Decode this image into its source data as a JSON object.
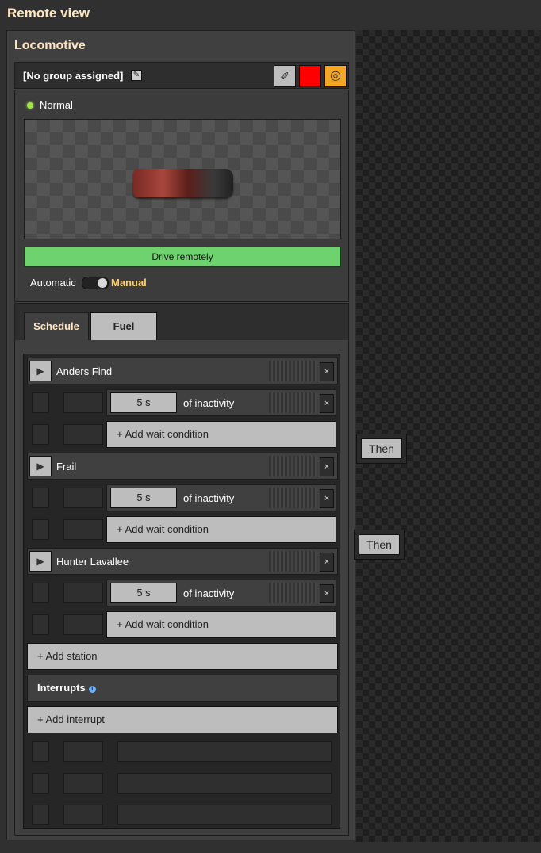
{
  "window": {
    "title": "Remote view"
  },
  "panel": {
    "title": "Locomotive",
    "group_label": "[No group assigned]",
    "color_hex": "#ff0000",
    "status": "Normal",
    "drive_label": "Drive remotely",
    "automatic_label": "Automatic",
    "manual_label": "Manual"
  },
  "tabs": [
    {
      "label": "Schedule",
      "active": true
    },
    {
      "label": "Fuel",
      "active": false
    }
  ],
  "schedule": {
    "stations": [
      {
        "name": "Anders Find",
        "condition": {
          "time": "5 s",
          "text": "of inactivity"
        }
      },
      {
        "name": "Frail",
        "condition": {
          "time": "5 s",
          "text": "of inactivity"
        }
      },
      {
        "name": "Hunter Lavallee",
        "condition": {
          "time": "5 s",
          "text": "of inactivity"
        }
      }
    ],
    "add_wait_label": "+ Add wait condition",
    "add_station_label": "+ Add station",
    "interrupts_label": "Interrupts",
    "add_interrupt_label": "+ Add interrupt"
  },
  "map": {
    "then_labels": [
      "Then",
      "Then"
    ]
  }
}
